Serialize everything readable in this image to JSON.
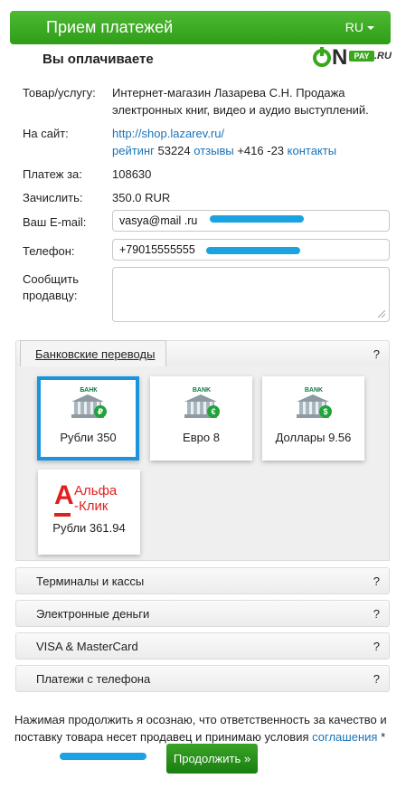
{
  "header": {
    "title": "Прием платежей",
    "lang": "RU"
  },
  "order": {
    "paying_title": "Вы оплачиваете",
    "product_label": "Товар/услугу:",
    "product_line1": "Интернет-магазин Лазарева С.Н. Продажа",
    "product_line2": "электронных книг, видео и аудио выступлений.",
    "site_label": "На сайт:",
    "site_url": "http://shop.lazarev.ru/",
    "rating_label": "рейтинг",
    "rating_value": "53224",
    "reviews_label": "отзывы",
    "reviews_value": "+416 -23",
    "contacts_label": "контакты",
    "payment_label": "Платеж за:",
    "payment_value": "108630",
    "credit_label": "Зачислить:",
    "credit_value": "350.0 RUR"
  },
  "form": {
    "email_label": "Ваш E-mail:",
    "email_value": "vasya@mail .ru",
    "phone_label": "Телефон:",
    "phone_value": "+79015555555",
    "message_label_line1": "Сообщить",
    "message_label_line2": "продавцу:"
  },
  "methods": {
    "bank_transfers": "Банковские переводы",
    "help": "?",
    "tiles": [
      {
        "caption": "Рубли 350",
        "coin": "₽",
        "sign": "БАНК"
      },
      {
        "caption": "Евро 8",
        "coin": "€",
        "sign": "BANK"
      },
      {
        "caption": "Доллары 9.56",
        "coin": "$",
        "sign": "BANK"
      }
    ],
    "alfa": {
      "logo_line1": "Альфа",
      "logo_line2": "-Клик",
      "caption": "Рубли 361.94"
    },
    "terminals": "Терминалы и кассы",
    "emoney": "Электронные деньги",
    "cards": "VISA & MasterCard",
    "phone_payments": "Платежи с телефона"
  },
  "footer": {
    "note": "Нажимая продолжить я осознаю, что ответственность за качество и поставку товара несет продавец и принимаю условия",
    "agreement_link": "соглашения",
    "asterisk": "*",
    "continue_button": "Продолжить »"
  },
  "colors": {
    "brand_green": "#3aa326",
    "link": "#1a73b8",
    "selected": "#1a95dc",
    "scribble": "#1aa3e0"
  }
}
